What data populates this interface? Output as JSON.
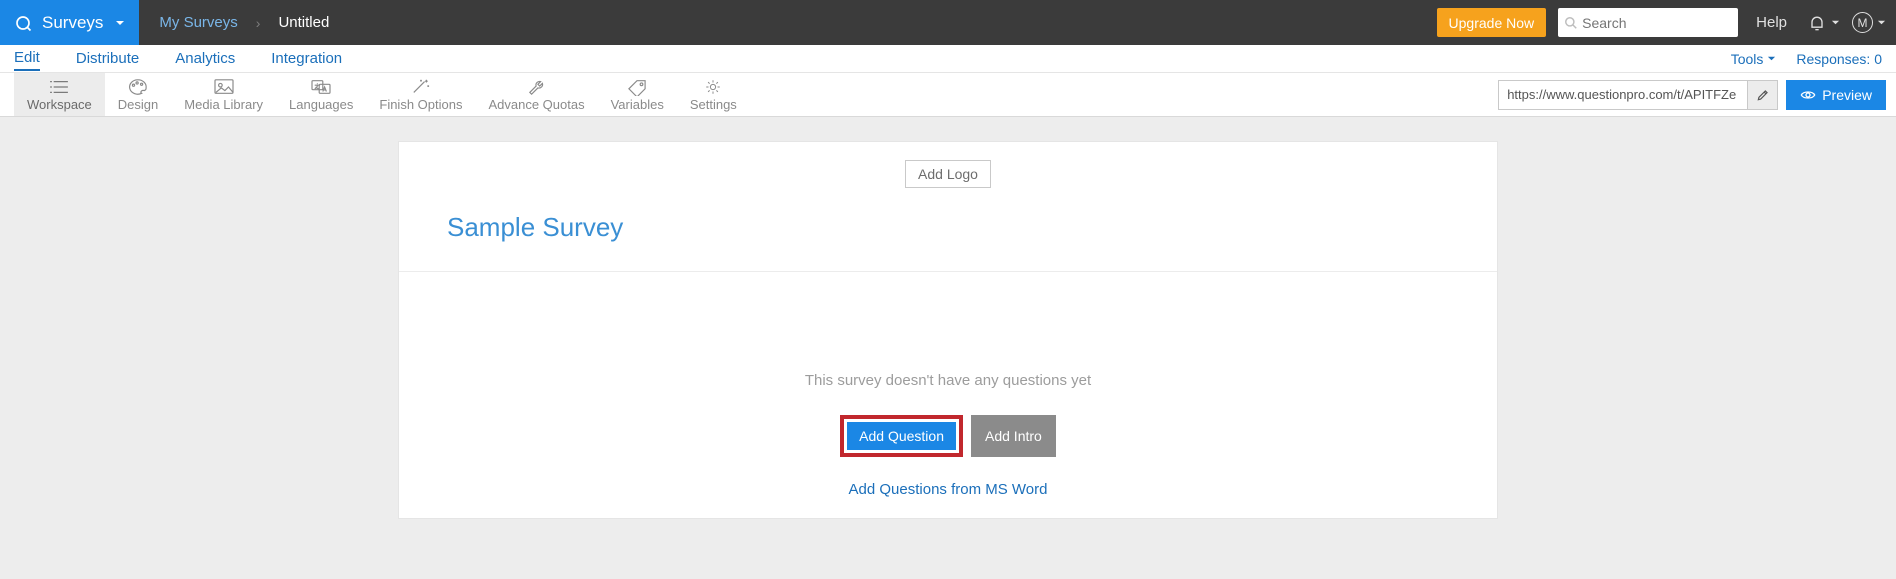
{
  "topbar": {
    "brand": "Surveys",
    "breadcrumb_parent": "My Surveys",
    "breadcrumb_current": "Untitled",
    "upgrade_label": "Upgrade Now",
    "search_placeholder": "Search",
    "help_label": "Help",
    "avatar_initial": "M"
  },
  "tabs": {
    "edit": "Edit",
    "distribute": "Distribute",
    "analytics": "Analytics",
    "integration": "Integration",
    "tools": "Tools",
    "responses_label": "Responses: 0"
  },
  "toolbar": {
    "workspace": "Workspace",
    "design": "Design",
    "media": "Media Library",
    "languages": "Languages",
    "finish": "Finish Options",
    "quotas": "Advance Quotas",
    "variables": "Variables",
    "settings": "Settings",
    "url_value": "https://www.questionpro.com/t/APITFZe",
    "preview_label": "Preview"
  },
  "canvas": {
    "add_logo_label": "Add Logo",
    "title": "Sample Survey",
    "empty_text": "This survey doesn't have any questions yet",
    "add_question_label": "Add Question",
    "add_intro_label": "Add Intro",
    "msword_label": "Add Questions from MS Word"
  }
}
